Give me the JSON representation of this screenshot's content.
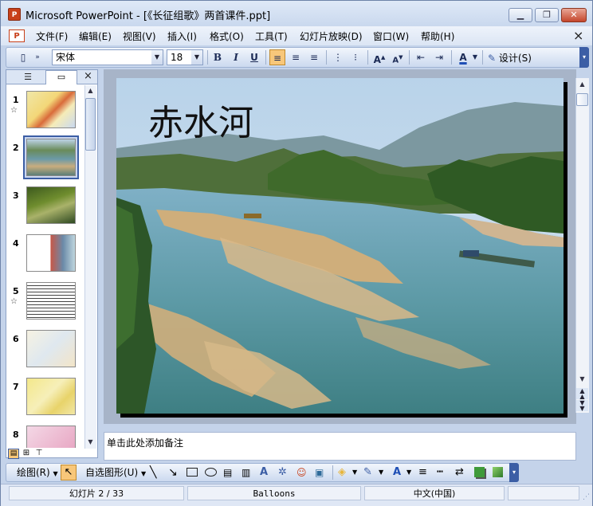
{
  "window": {
    "title": "Microsoft PowerPoint - [《长征组歌》两首课件.ppt]",
    "app_icon_label": "P"
  },
  "menu": {
    "items": [
      "文件(F)",
      "编辑(E)",
      "视图(V)",
      "插入(I)",
      "格式(O)",
      "工具(T)",
      "幻灯片放映(D)",
      "窗口(W)",
      "帮助(H)"
    ],
    "close_glyph": "×"
  },
  "toolbar": {
    "font_name": "宋体",
    "font_size": "18",
    "bold": "B",
    "italic": "I",
    "underline": "U",
    "design_label": "设计(S)"
  },
  "slides_panel": {
    "slides": [
      {
        "num": "1",
        "has_star": true
      },
      {
        "num": "2",
        "has_star": false,
        "selected": true
      },
      {
        "num": "3",
        "has_star": false
      },
      {
        "num": "4",
        "has_star": false
      },
      {
        "num": "5",
        "has_star": true
      },
      {
        "num": "6",
        "has_star": false
      },
      {
        "num": "7",
        "has_star": false
      },
      {
        "num": "8",
        "has_star": false
      }
    ],
    "star_glyph": "☆"
  },
  "slide": {
    "title": "赤水河"
  },
  "notes": {
    "placeholder": "单击此处添加备注"
  },
  "drawing_toolbar": {
    "draw_label": "绘图(R)",
    "autoshapes_label": "自选图形(U)"
  },
  "status": {
    "slide_position": "幻灯片 2 / 33",
    "design_template": "Balloons",
    "language": "中文(中国)"
  },
  "colors": {
    "accent": "#3c5ea5",
    "selected_button": "#f8c77a"
  }
}
